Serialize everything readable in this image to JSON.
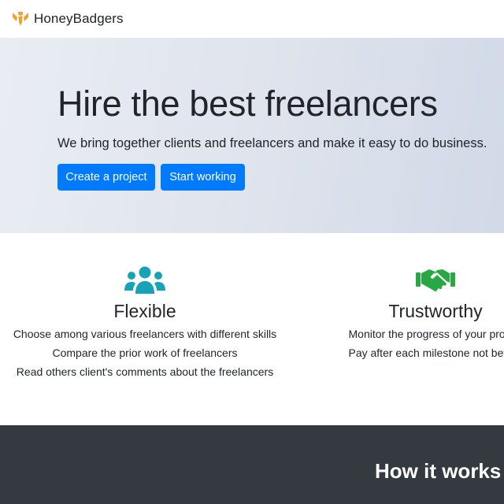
{
  "navbar": {
    "brand_name": "HoneyBadgers",
    "logo_icon": "honey-badger-logo-icon",
    "logo_color": "#f0a030"
  },
  "hero": {
    "title": "Hire the best freelancers",
    "lead": "We bring together clients and freelancers and make it easy to do business.",
    "buttons": {
      "create_label": "Create a project",
      "start_label": "Start working"
    },
    "button_color": "#007bff"
  },
  "features": [
    {
      "icon": "users-group-icon",
      "icon_color": "#17a2b8",
      "title": "Flexible",
      "lines": [
        "Choose among various freelancers with different skills",
        "Compare the prior work of freelancers",
        "Read others client's comments about the freelancers"
      ]
    },
    {
      "icon": "handshake-icon",
      "icon_color": "#28a745",
      "title": "Trustworthy",
      "lines": [
        "Monitor the progress of your project",
        "Pay after each milestone not before"
      ]
    }
  ],
  "how_it_works": {
    "title": "How it works",
    "background_color": "#343a40"
  }
}
